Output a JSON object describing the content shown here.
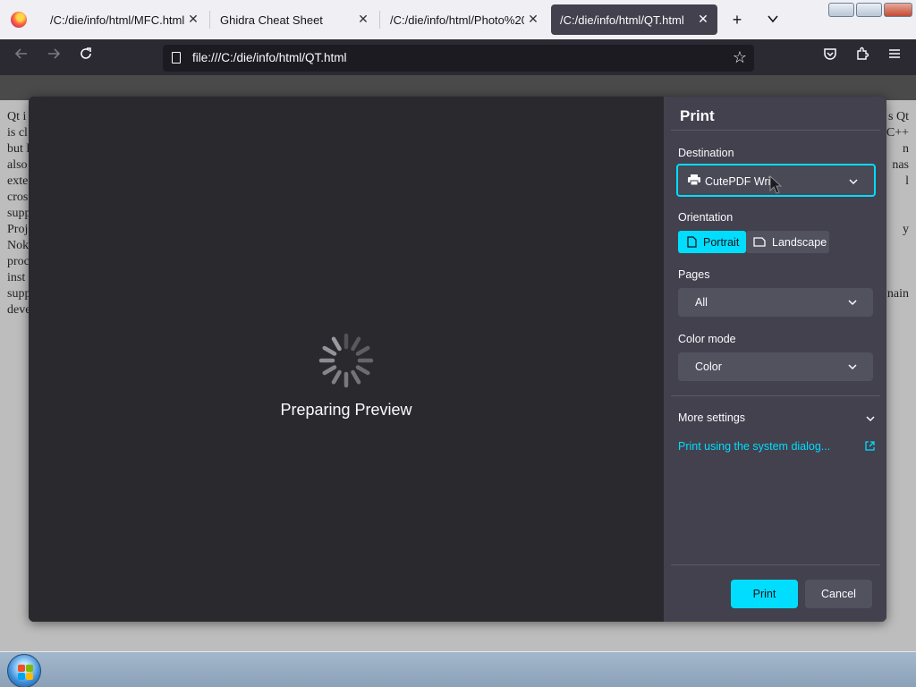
{
  "browser": {
    "tabs": [
      {
        "label": "/C:/die/info/html/MFC.html",
        "selected": false
      },
      {
        "label": "Ghidra Cheat Sheet",
        "selected": false
      },
      {
        "label": "/C:/die/info/html/Photo%20",
        "selected": false
      },
      {
        "label": "/C:/die/info/html/QT.html",
        "selected": true
      }
    ],
    "new_tab_label": "+",
    "tab_list_label": "⌄",
    "url": "file:///C:/die/info/html/QT.html"
  },
  "page": {
    "left_lines": [
      "Qt i",
      "is cl",
      "but l",
      "also",
      "exte",
      "cros",
      "supp",
      "Proj",
      "Nok",
      "proc",
      "inst",
      "supp",
      "deve"
    ],
    "right_lines": [
      "s Qt",
      "C++",
      "n",
      "nas",
      "l",
      "",
      "",
      "y",
      "",
      "",
      "",
      "nain",
      ""
    ]
  },
  "print_dialog": {
    "preview_status": "Preparing Preview",
    "title": "Print",
    "destination_label": "Destination",
    "destination_value": "CutePDF Writ",
    "orientation_label": "Orientation",
    "portrait_label": "Portrait",
    "landscape_label": "Landscape",
    "pages_label": "Pages",
    "pages_value": "All",
    "color_mode_label": "Color mode",
    "color_mode_value": "Color",
    "more_settings_label": "More settings",
    "system_dialog_label": "Print using the system dialog...",
    "print_button": "Print",
    "cancel_button": "Cancel",
    "accent_color": "#00ddff"
  }
}
